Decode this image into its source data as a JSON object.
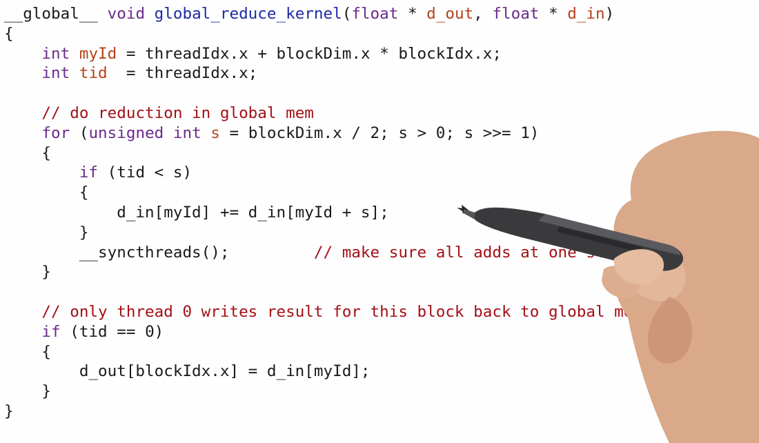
{
  "code": {
    "lines": [
      [
        {
          "t": "__global__ ",
          "c": "plain"
        },
        {
          "t": "void ",
          "c": "kw"
        },
        {
          "t": "global_reduce_kernel",
          "c": "fn"
        },
        {
          "t": "(",
          "c": "plain"
        },
        {
          "t": "float",
          "c": "kw"
        },
        {
          "t": " * ",
          "c": "plain"
        },
        {
          "t": "d_out",
          "c": "var"
        },
        {
          "t": ", ",
          "c": "plain"
        },
        {
          "t": "float",
          "c": "kw"
        },
        {
          "t": " * ",
          "c": "plain"
        },
        {
          "t": "d_in",
          "c": "var"
        },
        {
          "t": ")",
          "c": "plain"
        }
      ],
      [
        {
          "t": "{",
          "c": "plain"
        }
      ],
      [
        {
          "t": "    ",
          "c": "plain"
        },
        {
          "t": "int ",
          "c": "kw"
        },
        {
          "t": "myId",
          "c": "var"
        },
        {
          "t": " = threadIdx.x + blockDim.x * blockIdx.x;",
          "c": "plain"
        }
      ],
      [
        {
          "t": "    ",
          "c": "plain"
        },
        {
          "t": "int ",
          "c": "kw"
        },
        {
          "t": "tid",
          "c": "var"
        },
        {
          "t": "  = threadIdx.x;",
          "c": "plain"
        }
      ],
      [
        {
          "t": "",
          "c": "plain"
        }
      ],
      [
        {
          "t": "    ",
          "c": "plain"
        },
        {
          "t": "// do reduction in global mem",
          "c": "com"
        }
      ],
      [
        {
          "t": "    ",
          "c": "plain"
        },
        {
          "t": "for",
          "c": "kw"
        },
        {
          "t": " (",
          "c": "plain"
        },
        {
          "t": "unsigned int ",
          "c": "kw"
        },
        {
          "t": "s",
          "c": "var"
        },
        {
          "t": " = blockDim.x / 2; s > 0; s >>= 1)",
          "c": "plain"
        }
      ],
      [
        {
          "t": "    {",
          "c": "plain"
        }
      ],
      [
        {
          "t": "        ",
          "c": "plain"
        },
        {
          "t": "if",
          "c": "kw"
        },
        {
          "t": " (tid < s)",
          "c": "plain"
        }
      ],
      [
        {
          "t": "        {",
          "c": "plain"
        }
      ],
      [
        {
          "t": "            d_in[myId] += d_in[myId + s];",
          "c": "plain"
        }
      ],
      [
        {
          "t": "        }",
          "c": "plain"
        }
      ],
      [
        {
          "t": "        __syncthreads();         ",
          "c": "plain"
        },
        {
          "t": "// make sure all adds at one stage are done!",
          "c": "com"
        }
      ],
      [
        {
          "t": "    }",
          "c": "plain"
        }
      ],
      [
        {
          "t": "",
          "c": "plain"
        }
      ],
      [
        {
          "t": "    ",
          "c": "plain"
        },
        {
          "t": "// only thread 0 writes result for this block back to global mem",
          "c": "com"
        }
      ],
      [
        {
          "t": "    ",
          "c": "plain"
        },
        {
          "t": "if",
          "c": "kw"
        },
        {
          "t": " (tid == 0)",
          "c": "plain"
        }
      ],
      [
        {
          "t": "    {",
          "c": "plain"
        }
      ],
      [
        {
          "t": "        d_out[blockIdx.x] = d_in[myId];",
          "c": "plain"
        }
      ],
      [
        {
          "t": "    }",
          "c": "plain"
        }
      ],
      [
        {
          "t": "}",
          "c": "plain"
        }
      ]
    ]
  },
  "colors": {
    "keyword": "#6b2a8a",
    "function": "#1d2aa6",
    "variable": "#b3421a",
    "comment": "#a30f16",
    "plain": "#1a1a1a"
  },
  "overlay": {
    "icon": "stylus-pen-in-hand"
  }
}
